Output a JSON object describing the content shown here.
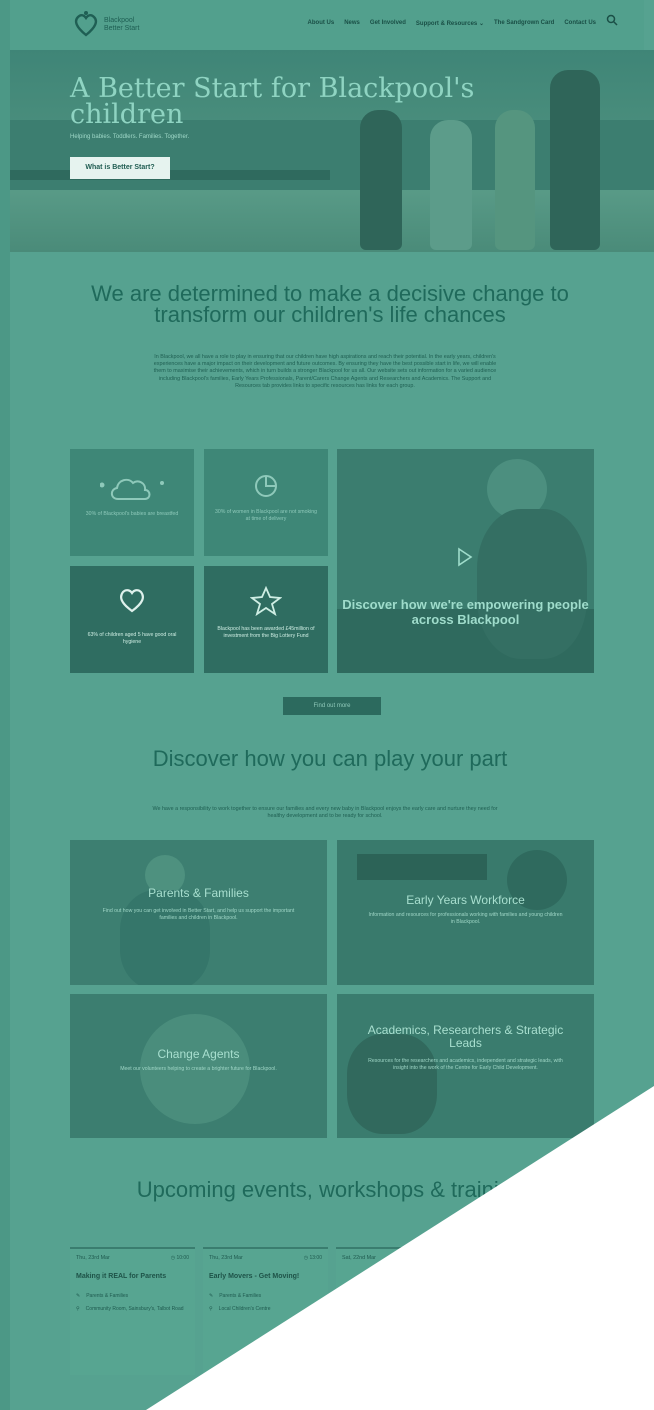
{
  "nav": {
    "logo_text": [
      "Blackpool",
      "Better Start"
    ],
    "links": [
      "About Us",
      "News",
      "Get Involved",
      "Support & Resources",
      "The Sandgrown Card",
      "Contact Us"
    ]
  },
  "hero": {
    "title": "A Better Start for Blackpool's children",
    "subtitle": "Helping babies. Toddlers. Families. Together.",
    "button": "What is Better Start?"
  },
  "intro": {
    "heading": "We are determined to make a decisive change to transform our children's life chances",
    "paragraph": "In Blackpool, we all have a role to play in ensuring that our children have high aspirations and reach their potential. In the early years, children's experiences have a major impact on their development and future outcomes. By ensuring they have the best possible start in life, we will enable them to maximise their achievements, which in turn builds a stronger Blackpool for us all. Our website sets out information for a varied audience including Blackpool's families, Early Years Professionals, Parent/Carers Change Agents and Researchers and Academics. The Support and Resources tab provides links to specific resources has links for each group."
  },
  "stats": [
    {
      "text": "30% of Blackpool's babies are breastfed",
      "icon": "cloud-icon"
    },
    {
      "text": "30% of women in Blackpool are not smoking at time of delivery",
      "icon": "pie-chart-icon"
    },
    {
      "text": "63% of children aged 5 have good oral hygiene",
      "icon": "heart-icon"
    },
    {
      "text": "Blackpool has been awarded £45million of investment from the Big Lottery Fund",
      "icon": "star-icon"
    }
  ],
  "video": {
    "caption": "Discover how we're empowering people across Blackpool"
  },
  "find_out_more": "Find out more",
  "discover": {
    "heading": "Discover how you can play your part",
    "paragraph": "We have a responsibility to work together to ensure our families and every new baby in Blackpool enjoys the early care and nurture they need for healthy development and to be ready for school."
  },
  "cards": [
    {
      "title": "Parents & Families",
      "desc": "Find out how you can get involved in Better Start, and help us support the important families and children in Blackpool."
    },
    {
      "title": "Early Years Workforce",
      "desc": "Information and resources for professionals working with families and young children in Blackpool."
    },
    {
      "title": "Change Agents",
      "desc": "Meet our volunteers helping to create a brighter future for Blackpool."
    },
    {
      "title": "Academics, Researchers & Strategic Leads",
      "desc": "Resources for the researchers and academics, independent and strategic leads, with insight into the work of the Centre for Early Child Development."
    }
  ],
  "events": {
    "heading": "Upcoming events, workshops & training",
    "items": [
      {
        "date": "Thu, 23rd Mar",
        "time": "10:00",
        "title": "Making it REAL for Parents",
        "audience": "Parents & Families",
        "location": "Community Room, Sainsbury's, Talbot Road"
      },
      {
        "date": "Thu, 23rd Mar",
        "time": "13:00",
        "title": "Early Movers - Get Moving!",
        "audience": "Parents & Families",
        "location": "Local Children's Centre"
      },
      {
        "date": "Sat, 22nd Mar",
        "time": "",
        "title": "",
        "audience": "",
        "location": ""
      }
    ]
  },
  "colors": {
    "teal": "#56a290",
    "dark_teal": "#2f6d61",
    "white": "#ffffff"
  }
}
